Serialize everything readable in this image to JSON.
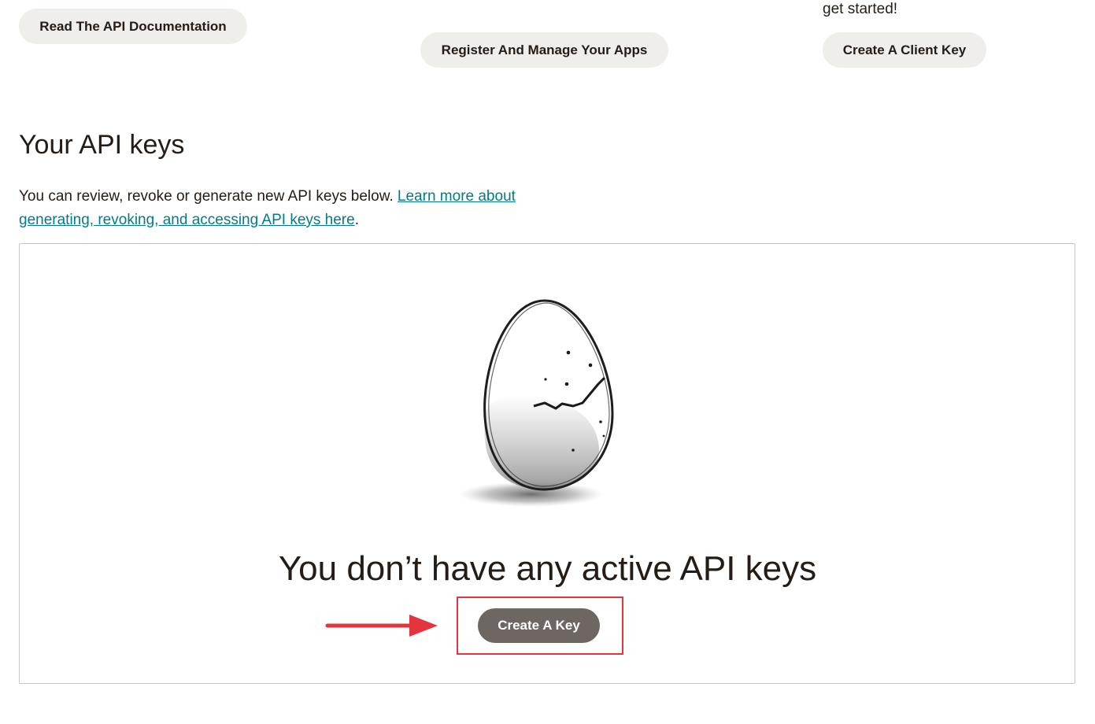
{
  "top_buttons": {
    "docs_label": "Read The API Documentation",
    "apps_label": "Register And Manage Your Apps",
    "client_label": "Create A Client Key",
    "get_started_text": "get started!"
  },
  "api_keys": {
    "title": "Your API keys",
    "description": "You can review, revoke or generate new API keys below. ",
    "link_text": "Learn more about generating, revoking, and accessing API keys here",
    "description_end": "."
  },
  "empty_state": {
    "illustration": "cracked-egg-illustration",
    "title": "You don’t have any active API keys",
    "create_label": "Create A Key"
  },
  "annotation": {
    "arrow_icon": "arrow-right-icon",
    "highlight_color": "#e4353f"
  },
  "colors": {
    "link": "#007c89",
    "pill_bg": "#efeeea",
    "primary_btn": "#6e6663",
    "text": "#241c15"
  }
}
